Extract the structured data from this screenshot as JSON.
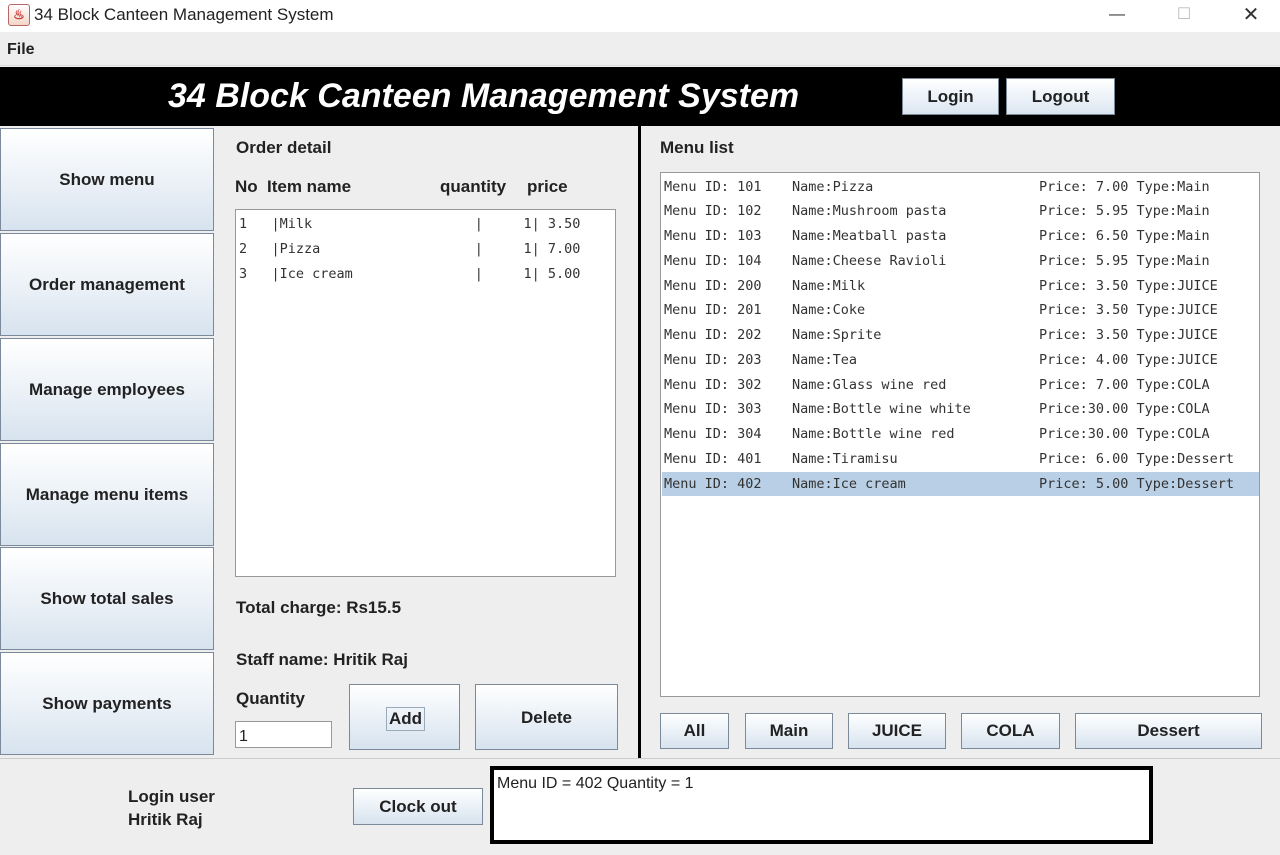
{
  "window": {
    "title": "34 Block Canteen Management System",
    "minimize": "—",
    "maximize": "☐",
    "close": "✕"
  },
  "menubar": {
    "file": "File"
  },
  "header": {
    "title": "34 Block Canteen Management System",
    "login": "Login",
    "logout": "Logout"
  },
  "nav": [
    "Show menu",
    "Order management",
    "Manage employees",
    "Manage menu items",
    "Show total sales",
    "Show payments"
  ],
  "order": {
    "title": "Order detail",
    "col_no": "No",
    "col_item": "Item name",
    "col_qty": "quantity",
    "col_price": "price",
    "rows": [
      "1   |Milk                    |     1| 3.50",
      "2   |Pizza                   |     1| 7.00",
      "3   |Ice cream               |     1| 5.00"
    ],
    "total": "Total charge: Rs15.5",
    "staff": "Staff name: Hritik Raj",
    "quantity_label": "Quantity",
    "quantity_value": "1",
    "add": "Add",
    "delete": "Delete"
  },
  "menu": {
    "title": "Menu list",
    "items": [
      {
        "id": "Menu ID: 101",
        "name": "Name:Pizza",
        "price": "Price: 7.00 Type:Main"
      },
      {
        "id": "Menu ID: 102",
        "name": "Name:Mushroom pasta",
        "price": "Price: 5.95 Type:Main"
      },
      {
        "id": "Menu ID: 103",
        "name": "Name:Meatball pasta",
        "price": "Price: 6.50 Type:Main"
      },
      {
        "id": "Menu ID: 104",
        "name": "Name:Cheese Ravioli",
        "price": "Price: 5.95 Type:Main"
      },
      {
        "id": "Menu ID: 200",
        "name": "Name:Milk",
        "price": "Price: 3.50 Type:JUICE"
      },
      {
        "id": "Menu ID: 201",
        "name": "Name:Coke",
        "price": "Price: 3.50 Type:JUICE"
      },
      {
        "id": "Menu ID: 202",
        "name": "Name:Sprite",
        "price": "Price: 3.50 Type:JUICE"
      },
      {
        "id": "Menu ID: 203",
        "name": "Name:Tea",
        "price": "Price: 4.00 Type:JUICE"
      },
      {
        "id": "Menu ID: 302",
        "name": "Name:Glass wine red",
        "price": "Price: 7.00 Type:COLA"
      },
      {
        "id": "Menu ID: 303",
        "name": "Name:Bottle wine white",
        "price": "Price:30.00 Type:COLA"
      },
      {
        "id": "Menu ID: 304",
        "name": "Name:Bottle wine red",
        "price": "Price:30.00 Type:COLA"
      },
      {
        "id": "Menu ID: 401",
        "name": "Name:Tiramisu",
        "price": "Price: 6.00 Type:Dessert"
      },
      {
        "id": "Menu ID: 402",
        "name": "Name:Ice cream",
        "price": "Price: 5.00 Type:Dessert"
      }
    ],
    "selected_index": 12,
    "filters": [
      "All",
      "Main",
      "JUICE",
      "COLA",
      "Dessert"
    ]
  },
  "footer": {
    "login_user_label": "Login user",
    "login_user_name": "Hritik Raj",
    "clock_out": "Clock out",
    "status": "Menu ID = 402 Quantity = 1"
  }
}
